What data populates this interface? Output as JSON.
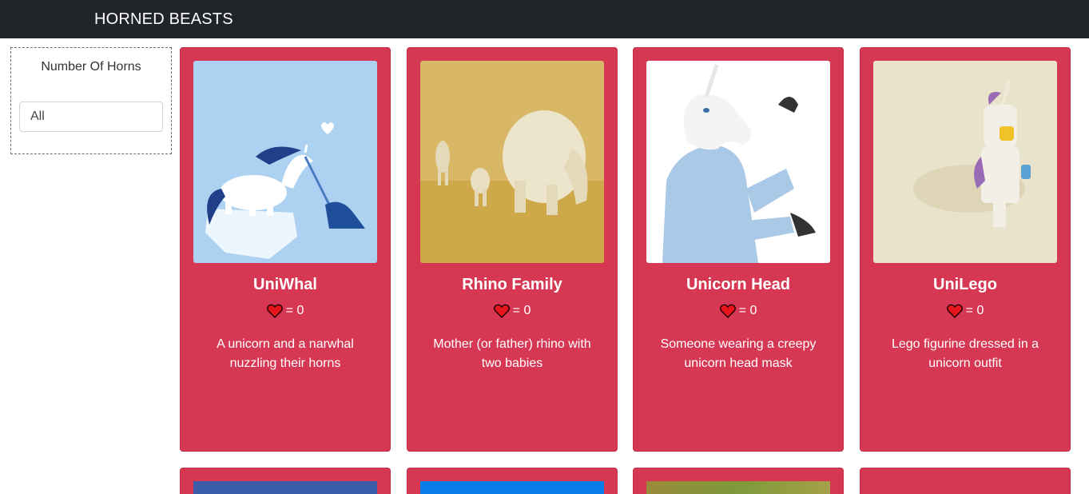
{
  "navbar": {
    "brand": "HORNED BEASTS"
  },
  "filter": {
    "title": "Number Of Horns",
    "selected": "All"
  },
  "cards": [
    {
      "title": "UniWhal",
      "likes_text": "= 0",
      "description": "A unicorn and a narwhal nuzzling their horns"
    },
    {
      "title": "Rhino Family",
      "likes_text": "= 0",
      "description": "Mother (or father) rhino with two babies"
    },
    {
      "title": "Unicorn Head",
      "likes_text": "= 0",
      "description": "Someone wearing a creepy unicorn head mask"
    },
    {
      "title": "UniLego",
      "likes_text": "= 0",
      "description": "Lego figurine dressed in a unicorn outfit"
    }
  ],
  "colors": {
    "card": "#d63752",
    "navbar": "#212529"
  },
  "icons": {
    "like": "heart-icon"
  }
}
